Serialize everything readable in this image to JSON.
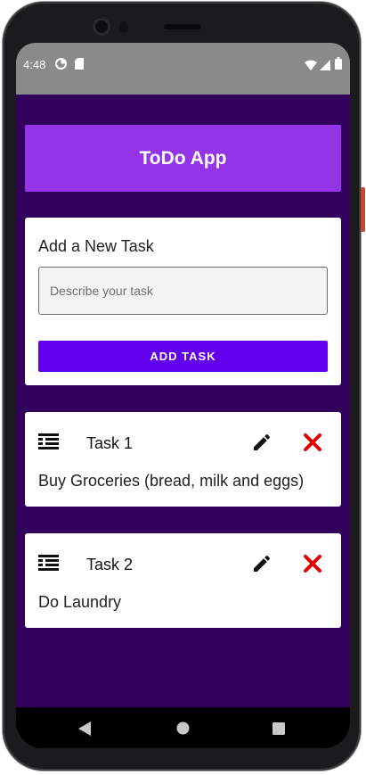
{
  "status_bar": {
    "time": "4:48",
    "left_icons": [
      "data-saver-icon",
      "sim-card-icon"
    ],
    "right_icons": [
      "wifi-icon",
      "cell-signal-icon",
      "battery-icon"
    ]
  },
  "app": {
    "title": "ToDo App",
    "colors": {
      "background": "#33005e",
      "app_bar": "#9334e6",
      "button": "#6200ee",
      "delete": "#e00000"
    }
  },
  "new_task": {
    "heading": "Add a New Task",
    "input_placeholder": "Describe your task",
    "input_value": "",
    "button_label": "ADD TASK"
  },
  "tasks": [
    {
      "title": "Task 1",
      "description": "Buy Groceries (bread, milk and eggs)",
      "icon": "list-lines-icon",
      "edit_icon": "pencil-icon",
      "delete_icon": "close-icon"
    },
    {
      "title": "Task 2",
      "description": "Do Laundry",
      "icon": "list-lines-icon",
      "edit_icon": "pencil-icon",
      "delete_icon": "close-icon"
    }
  ],
  "nav_bar": {
    "buttons": [
      "back-icon",
      "home-icon",
      "recents-icon"
    ]
  }
}
